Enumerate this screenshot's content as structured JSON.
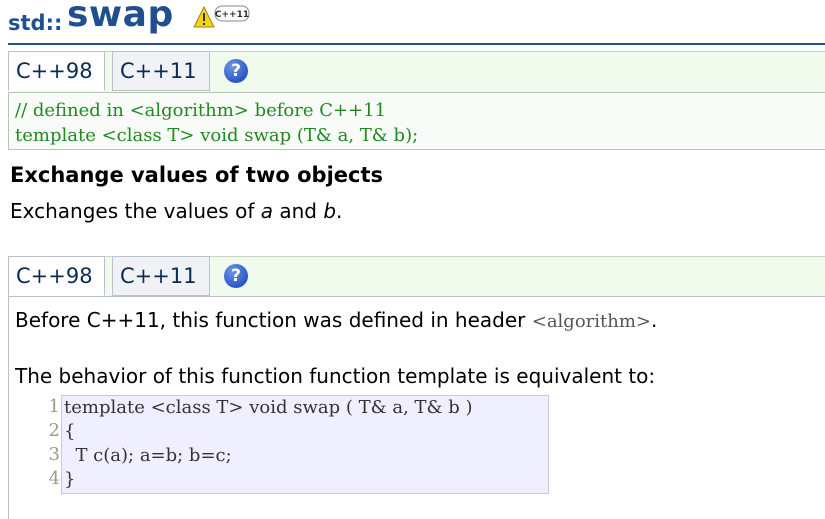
{
  "title": {
    "namespace": "std::",
    "name": "swap",
    "badge": "C++11"
  },
  "tabs_top": [
    {
      "label": "C++98"
    },
    {
      "label": "C++11"
    }
  ],
  "tabs_bottom": [
    {
      "label": "C++98"
    },
    {
      "label": "C++11"
    }
  ],
  "help_glyph": "?",
  "declaration": {
    "comment": "// defined in <algorithm> before C++11",
    "signature": "template <class T> void swap (T& a, T& b);"
  },
  "summary": {
    "heading": "Exchange values of two objects",
    "text_prefix": "Exchanges the values of ",
    "param_a": "a",
    "text_mid": " and ",
    "param_b": "b",
    "text_suffix": "."
  },
  "details": {
    "header_note_prefix": "Before C++11, this function was defined in header ",
    "header_name": "<algorithm>",
    "header_note_suffix": ".",
    "behavior": "The behavior of this function function template is equivalent to:"
  },
  "listing": {
    "line_numbers": [
      "1",
      "2",
      "3",
      "4"
    ],
    "lines": [
      "template <class T> void swap ( T& a, T& b )",
      "{",
      "  T c(a); a=b; b=c;",
      "}"
    ]
  },
  "colors": {
    "title": "#1f4f8f",
    "code_green": "#228822",
    "panel_green": "#f0fbee",
    "listing_bg": "#efefff"
  }
}
